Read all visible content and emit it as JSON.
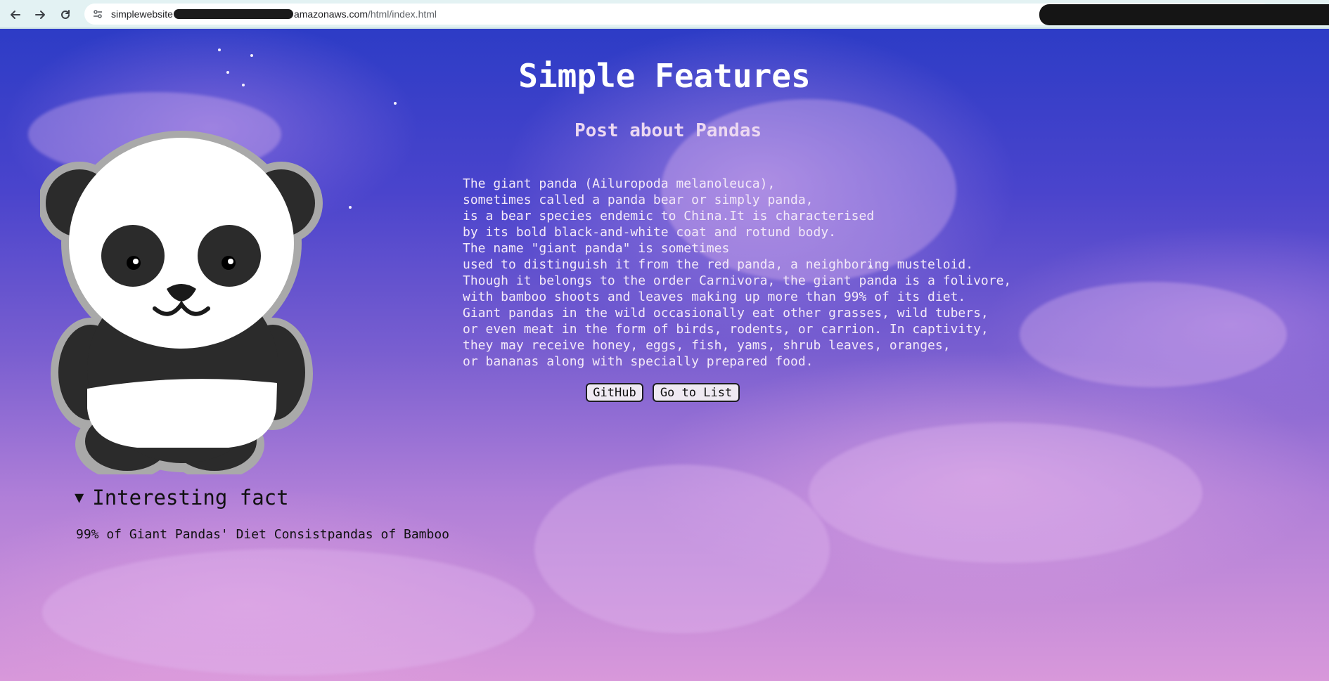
{
  "browser": {
    "url_host": "simplewebsite",
    "url_tail_domain": "amazonaws.com",
    "url_path": "/html/index.html"
  },
  "page": {
    "title": "Simple Features",
    "subtitle": "Post about Pandas",
    "post_text": "The giant panda (Ailuropoda melanoleuca),\nsometimes called a panda bear or simply panda,\nis a bear species endemic to China.It is characterised\nby its bold black-and-white coat and rotund body.\nThe name \"giant panda\" is sometimes\nused to distinguish it from the red panda, a neighboring musteloid.\nThough it belongs to the order Carnivora, the giant panda is a folivore,\nwith bamboo shoots and leaves making up more than 99% of its diet.\nGiant pandas in the wild occasionally eat other grasses, wild tubers,\nor even meat in the form of birds, rodents, or carrion. In captivity,\nthey may receive honey, eggs, fish, yams, shrub leaves, oranges,\nor bananas along with specially prepared food.",
    "buttons": {
      "github": "GitHub",
      "list": "Go to List"
    },
    "details": {
      "toggle_glyph": "▼",
      "summary": "Interesting fact",
      "content": "99% of Giant Pandas' Diet Consistpandas of Bamboo"
    }
  },
  "icons": {
    "back": "back-arrow-icon",
    "forward": "forward-arrow-icon",
    "reload": "reload-icon",
    "site_info": "site-info-icon"
  }
}
